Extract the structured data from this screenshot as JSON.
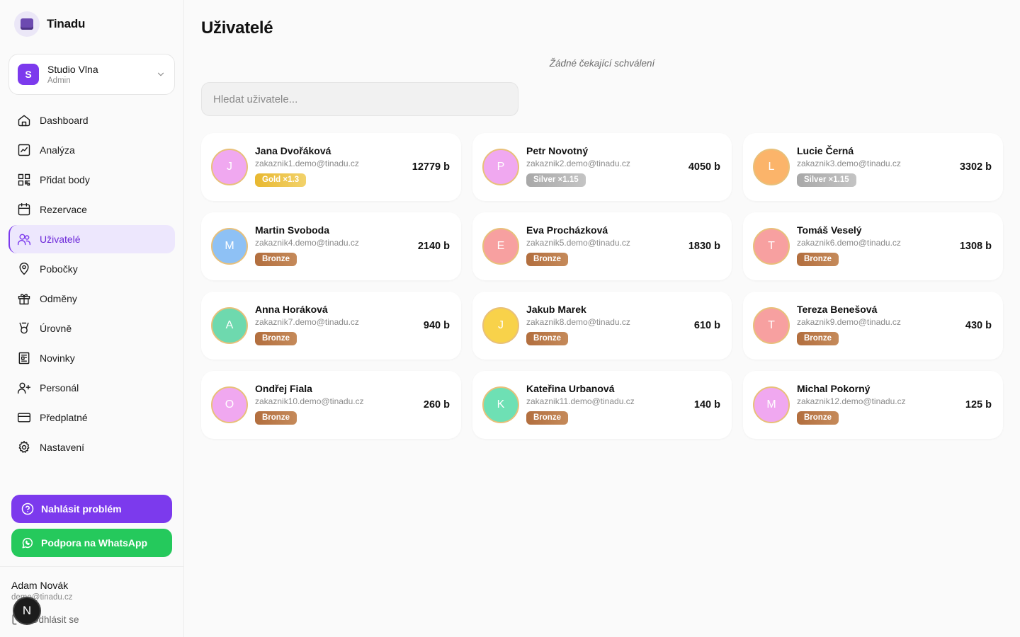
{
  "app": {
    "name": "Tinadu"
  },
  "org": {
    "initial": "S",
    "name": "Studio Vlna",
    "role": "Admin"
  },
  "nav": [
    {
      "label": "Dashboard",
      "icon": "home-icon"
    },
    {
      "label": "Analýza",
      "icon": "analytics-icon"
    },
    {
      "label": "Přidat body",
      "icon": "qr-code-icon"
    },
    {
      "label": "Rezervace",
      "icon": "calendar-icon"
    },
    {
      "label": "Uživatelé",
      "icon": "users-icon",
      "active": true
    },
    {
      "label": "Pobočky",
      "icon": "map-pin-icon"
    },
    {
      "label": "Odměny",
      "icon": "gift-icon"
    },
    {
      "label": "Úrovně",
      "icon": "medal-icon"
    },
    {
      "label": "Novinky",
      "icon": "newspaper-icon"
    },
    {
      "label": "Personál",
      "icon": "user-plus-icon"
    },
    {
      "label": "Předplatné",
      "icon": "credit-card-icon"
    },
    {
      "label": "Nastavení",
      "icon": "gear-icon"
    }
  ],
  "actions": {
    "report": "Nahlásit problém",
    "whatsapp": "Podpora na WhatsApp"
  },
  "user": {
    "name": "Adam Novák",
    "email": "demo@tinadu.cz",
    "logout": "Odhlásit se",
    "fab_initial": "N"
  },
  "page": {
    "title": "Uživatelé",
    "pending": "Žádné čekající schválení",
    "search_placeholder": "Hledat uživatele..."
  },
  "colors": {
    "accent": "#7c3aed",
    "whatsapp": "#25c95c",
    "gold": "#e8b830",
    "silver": "#a8a8a8",
    "bronze": "#b26e3e"
  },
  "users": [
    {
      "initial": "J",
      "name": "Jana Dvořáková",
      "email": "zakaznik1.demo@tinadu.cz",
      "badge": "Gold ×1.3",
      "tier": "gold",
      "points": "12779 b",
      "color": "#f0a8f0"
    },
    {
      "initial": "P",
      "name": "Petr Novotný",
      "email": "zakaznik2.demo@tinadu.cz",
      "badge": "Silver ×1.15",
      "tier": "silver",
      "points": "4050 b",
      "color": "#f0a8f0"
    },
    {
      "initial": "L",
      "name": "Lucie Černá",
      "email": "zakaznik3.demo@tinadu.cz",
      "badge": "Silver ×1.15",
      "tier": "silver",
      "points": "3302 b",
      "color": "#fbb46a"
    },
    {
      "initial": "M",
      "name": "Martin Svoboda",
      "email": "zakaznik4.demo@tinadu.cz",
      "badge": "Bronze",
      "tier": "bronze",
      "points": "2140 b",
      "color": "#8ec1f5"
    },
    {
      "initial": "E",
      "name": "Eva Procházková",
      "email": "zakaznik5.demo@tinadu.cz",
      "badge": "Bronze",
      "tier": "bronze",
      "points": "1830 b",
      "color": "#f7a0a0"
    },
    {
      "initial": "T",
      "name": "Tomáš Veselý",
      "email": "zakaznik6.demo@tinadu.cz",
      "badge": "Bronze",
      "tier": "bronze",
      "points": "1308 b",
      "color": "#f7a0a0"
    },
    {
      "initial": "A",
      "name": "Anna Horáková",
      "email": "zakaznik7.demo@tinadu.cz",
      "badge": "Bronze",
      "tier": "bronze",
      "points": "940 b",
      "color": "#6ed9ae"
    },
    {
      "initial": "J",
      "name": "Jakub Marek",
      "email": "zakaznik8.demo@tinadu.cz",
      "badge": "Bronze",
      "tier": "bronze",
      "points": "610 b",
      "color": "#f8d24a"
    },
    {
      "initial": "T",
      "name": "Tereza Benešová",
      "email": "zakaznik9.demo@tinadu.cz",
      "badge": "Bronze",
      "tier": "bronze",
      "points": "430 b",
      "color": "#f7a0a0"
    },
    {
      "initial": "O",
      "name": "Ondřej Fiala",
      "email": "zakaznik10.demo@tinadu.cz",
      "badge": "Bronze",
      "tier": "bronze",
      "points": "260 b",
      "color": "#f0a8f0"
    },
    {
      "initial": "K",
      "name": "Kateřina Urbanová",
      "email": "zakaznik11.demo@tinadu.cz",
      "badge": "Bronze",
      "tier": "bronze",
      "points": "140 b",
      "color": "#6ee0b4"
    },
    {
      "initial": "M",
      "name": "Michal Pokorný",
      "email": "zakaznik12.demo@tinadu.cz",
      "badge": "Bronze",
      "tier": "bronze",
      "points": "125 b",
      "color": "#f0a8f0"
    }
  ]
}
